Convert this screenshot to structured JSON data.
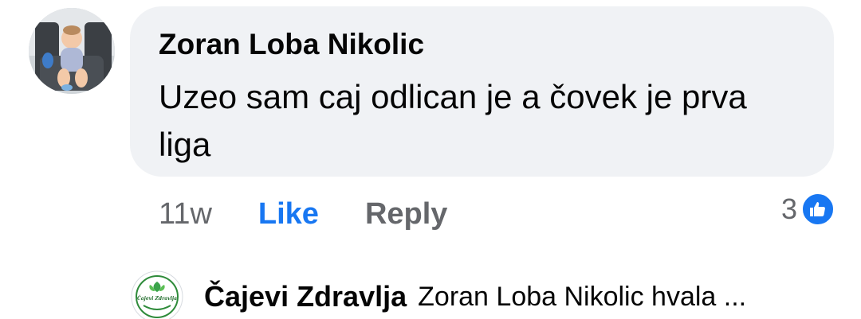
{
  "comment": {
    "author": "Zoran Loba Nikolic",
    "text": "Uzeo sam caj odlican je a čovek je prva liga",
    "timestamp": "11w",
    "like_label": "Like",
    "reply_label": "Reply",
    "reaction_count": "3",
    "reaction_icon": "thumbs-up-icon"
  },
  "reply": {
    "author": "Čajevi Zdravlja",
    "snippet": "Zoran Loba Nikolic hvala ...",
    "avatar_logo_text": "Čajevi Zdravlja"
  },
  "colors": {
    "bubble_bg": "#f0f2f5",
    "like_blue": "#1877f2",
    "secondary_text": "#65676b",
    "primary_text": "#050505"
  }
}
